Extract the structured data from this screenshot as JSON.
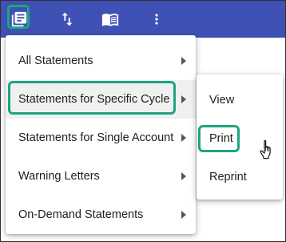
{
  "toolbar": {
    "background": "#3f51b5",
    "highlight_color": "#1ea483",
    "icons": [
      "statements-icon",
      "sort-icon",
      "book-icon",
      "more-vert-icon"
    ]
  },
  "menu": {
    "items": [
      {
        "label": "All Statements",
        "has_submenu": true
      },
      {
        "label": "Statements for Specific Cycle",
        "has_submenu": true,
        "active": true
      },
      {
        "label": "Statements for Single Account",
        "has_submenu": true
      },
      {
        "label": "Warning Letters",
        "has_submenu": true
      },
      {
        "label": "On-Demand Statements",
        "has_submenu": true
      }
    ]
  },
  "submenu": {
    "items": [
      {
        "label": "View"
      },
      {
        "label": "Print",
        "highlighted": true
      },
      {
        "label": "Reprint"
      }
    ]
  }
}
